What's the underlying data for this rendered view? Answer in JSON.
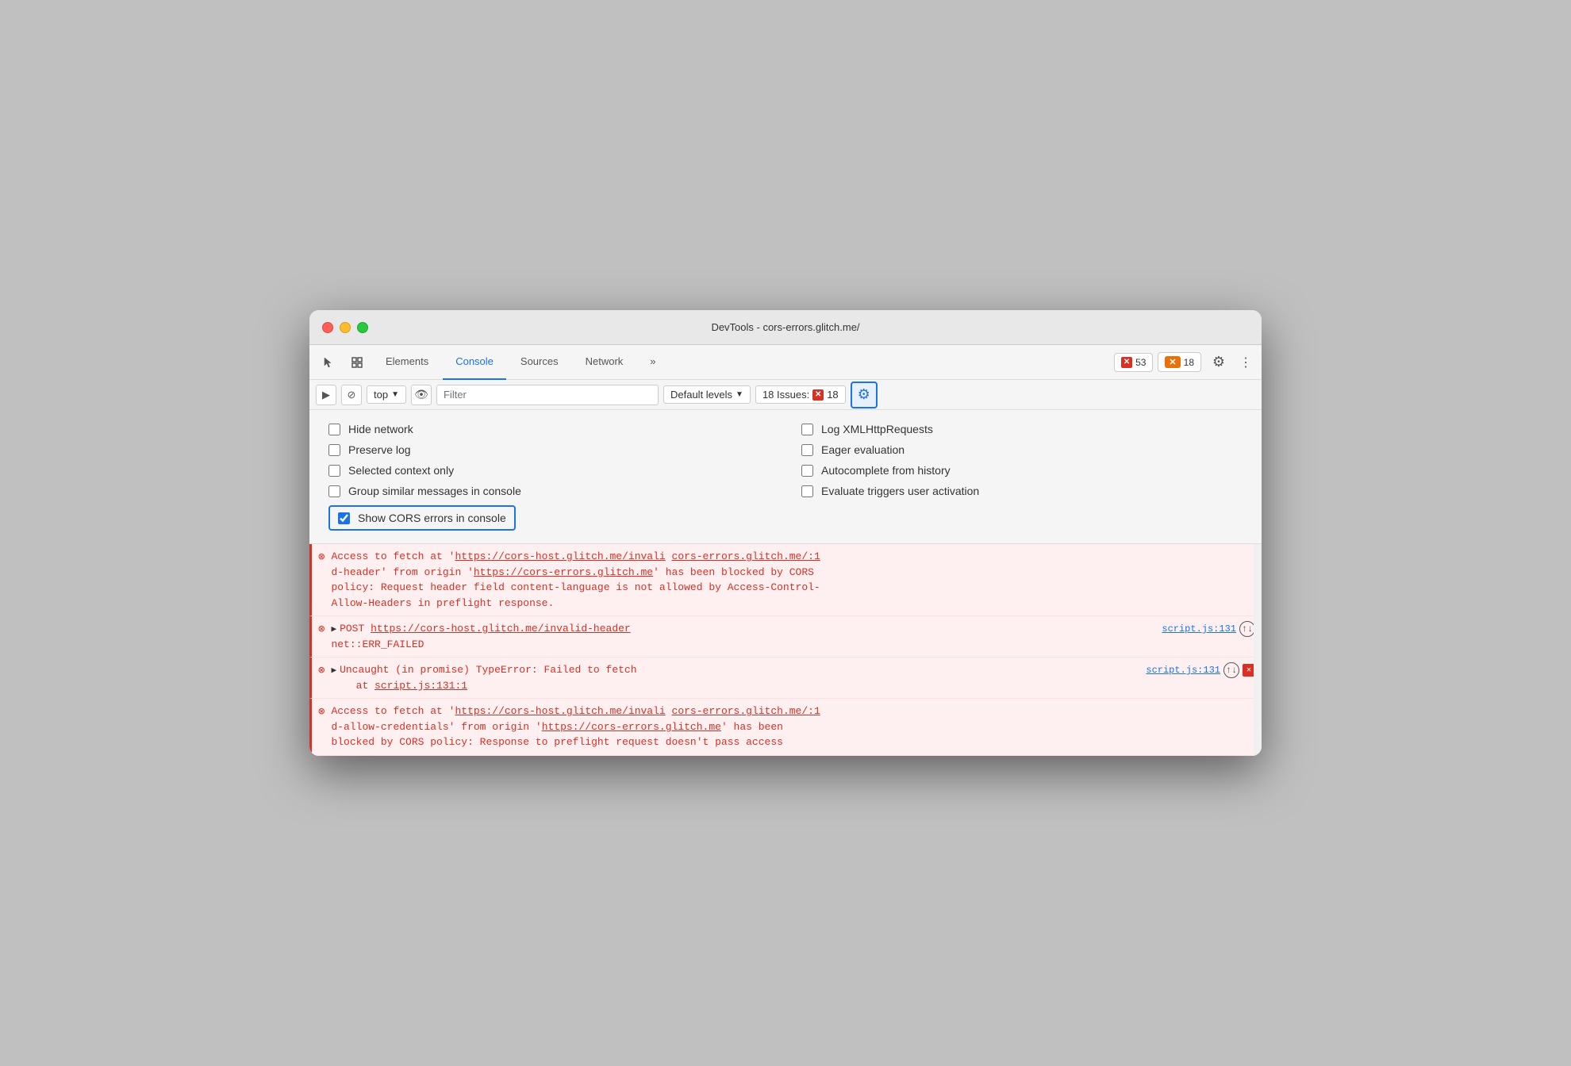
{
  "window": {
    "title": "DevTools - cors-errors.glitch.me/"
  },
  "toolbar": {
    "tabs": [
      {
        "id": "elements",
        "label": "Elements",
        "active": false
      },
      {
        "id": "console",
        "label": "Console",
        "active": true
      },
      {
        "id": "sources",
        "label": "Sources",
        "active": false
      },
      {
        "id": "network",
        "label": "Network",
        "active": false
      }
    ],
    "more_label": "»",
    "error_count": "53",
    "warning_count": "18",
    "gear_icon": "⚙",
    "more_icon": "⋮"
  },
  "console_toolbar": {
    "play_icon": "▶",
    "block_icon": "⊘",
    "top_label": "top",
    "dropdown_icon": "▼",
    "eye_icon": "👁",
    "filter_placeholder": "Filter",
    "default_levels_label": "Default levels",
    "dropdown_icon2": "▼",
    "issues_label": "18 Issues:",
    "issues_count": "18",
    "settings_icon": "⚙"
  },
  "settings": {
    "checkboxes_left": [
      {
        "id": "hide-network",
        "label": "Hide network",
        "checked": false
      },
      {
        "id": "preserve-log",
        "label": "Preserve log",
        "checked": false
      },
      {
        "id": "selected-context",
        "label": "Selected context only",
        "checked": false
      },
      {
        "id": "group-similar",
        "label": "Group similar messages in console",
        "checked": false
      }
    ],
    "checkboxes_right": [
      {
        "id": "log-xmlhttp",
        "label": "Log XMLHttpRequests",
        "checked": false
      },
      {
        "id": "eager-eval",
        "label": "Eager evaluation",
        "checked": false
      },
      {
        "id": "autocomplete-history",
        "label": "Autocomplete from history",
        "checked": false
      },
      {
        "id": "evaluate-triggers",
        "label": "Evaluate triggers user activation",
        "checked": false
      }
    ],
    "cors_checkbox": {
      "id": "show-cors",
      "label": "Show CORS errors in console",
      "checked": true
    }
  },
  "console_rows": [
    {
      "type": "error",
      "text": "Access to fetch at 'https://cors-host.glitch.me/invali cors-errors.glitch.me/:1\nd-header' from origin 'https://cors-errors.glitch.me' has been blocked by CORS\npolicy: Request header field content-language is not allowed by Access-Control-\nAllow-Headers in preflight response.",
      "link1": "https://cors-host.glitch.me/invali",
      "link2": "cors-errors.glitch.me/:1",
      "link3": "https://cors-errors.glitch.me"
    },
    {
      "type": "error",
      "expandable": true,
      "text": "POST https://cors-host.glitch.me/invalid-header",
      "subtext": "net::ERR_FAILED",
      "source": "script.js:131",
      "has_upload": true
    },
    {
      "type": "error",
      "expandable": true,
      "text": "Uncaught (in promise) TypeError: Failed to fetch\n    at script.js:131:1",
      "source": "script.js:131",
      "has_upload": true,
      "has_close": true
    },
    {
      "type": "error",
      "text": "Access to fetch at 'https://cors-host.glitch.me/invali cors-errors.glitch.me/:1\nd-allow-credentials' from origin 'https://cors-errors.glitch.me' has been\nblocked by CORS policy: Response to preflight request doesn't pass access",
      "link1": "https://cors-host.glitch.me/invali",
      "link2": "cors-errors.glitch.me/:1",
      "link3": "https://cors-errors.glitch.me"
    }
  ]
}
